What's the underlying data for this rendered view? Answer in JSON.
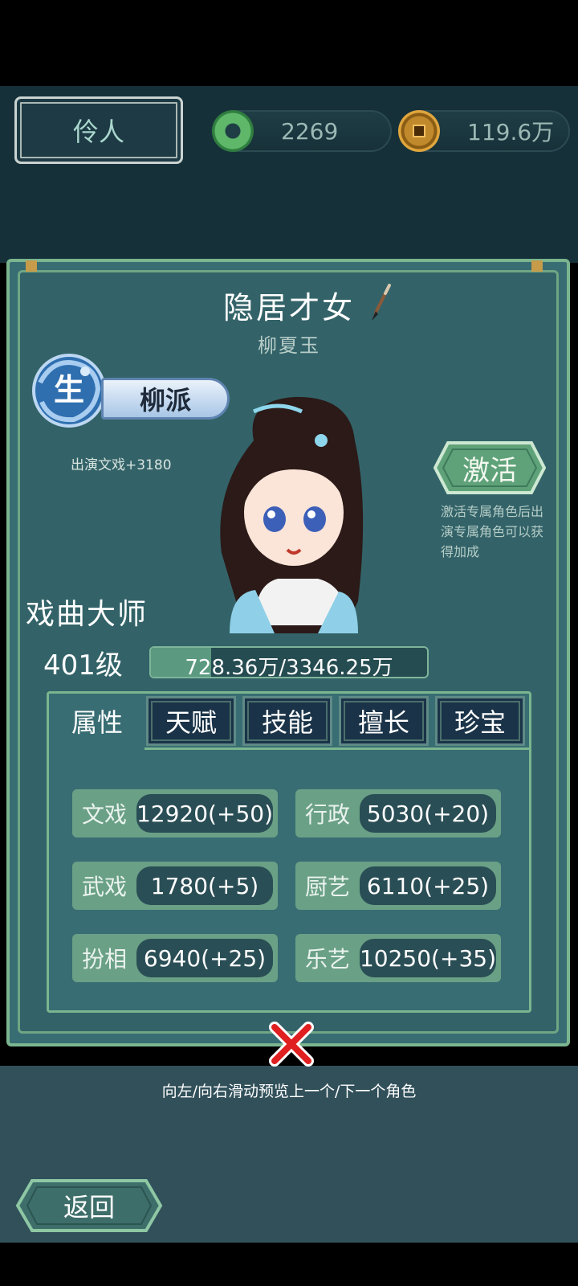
{
  "header": {
    "role_label": "伶人",
    "jade_amount": "2269",
    "coin_amount": "119.6万"
  },
  "character": {
    "title": "隐居才女",
    "name": "柳夏玉",
    "faction_emblem_char": "生",
    "faction": "柳派",
    "faction_bonus": "出演文戏+3180",
    "activate_label": "激活",
    "activate_desc": "激活专属角色后出演专属角色可以获得加成",
    "rank_title": "戏曲大师",
    "level": "401级",
    "exp_text": "728.36万/3346.25万",
    "exp_progress": 0.2177
  },
  "tabs": [
    "属性",
    "天赋",
    "技能",
    "擅长",
    "珍宝"
  ],
  "stats": [
    {
      "label": "文戏",
      "value": "12920(+50)"
    },
    {
      "label": "行政",
      "value": "5030(+20)"
    },
    {
      "label": "武戏",
      "value": "1780(+5)"
    },
    {
      "label": "厨艺",
      "value": "6110(+25)"
    },
    {
      "label": "扮相",
      "value": "6940(+25)"
    },
    {
      "label": "乐艺",
      "value": "10250(+35)"
    }
  ],
  "footer": {
    "hint": "向左/向右滑动预览上一个/下一个角色",
    "back_label": "返回"
  },
  "colors": {
    "panel": "#386d73",
    "frame": "#7bb58f",
    "stat_bg": "#6aa086",
    "close": "#e02020"
  }
}
